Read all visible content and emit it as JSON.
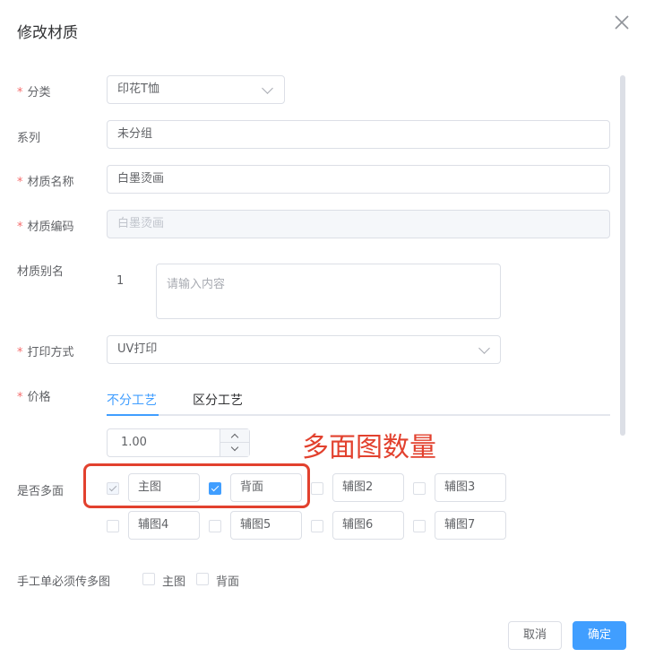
{
  "dialog": {
    "title": "修改材质",
    "cancel_label": "取消",
    "confirm_label": "确定"
  },
  "form": {
    "category": {
      "label": "分类",
      "required": true,
      "value": "印花T恤"
    },
    "series": {
      "label": "系列",
      "required": false,
      "value": "未分组"
    },
    "material_name": {
      "label": "材质名称",
      "required": true,
      "value": "白墨烫画"
    },
    "material_code": {
      "label": "材质编码",
      "required": true,
      "value": "白墨烫画"
    },
    "alias": {
      "label": "材质别名",
      "index": "1",
      "placeholder": "请输入内容"
    },
    "print_method": {
      "label": "打印方式",
      "required": true,
      "value": "UV打印"
    },
    "price": {
      "label": "价格",
      "required": true,
      "tabs": [
        "不分工艺",
        "区分工艺"
      ],
      "active_tab": 0,
      "value": "1.00"
    },
    "multi_face": {
      "label": "是否多面",
      "faces": [
        {
          "name": "主图",
          "checked": true,
          "disabled": true
        },
        {
          "name": "背面",
          "checked": true,
          "disabled": false
        },
        {
          "name": "辅图2",
          "checked": false,
          "disabled": false
        },
        {
          "name": "辅图3",
          "checked": false,
          "disabled": false
        },
        {
          "name": "辅图4",
          "checked": false,
          "disabled": false
        },
        {
          "name": "辅图5",
          "checked": false,
          "disabled": false
        },
        {
          "name": "辅图6",
          "checked": false,
          "disabled": false
        },
        {
          "name": "辅图7",
          "checked": false,
          "disabled": false
        }
      ]
    },
    "manual_required": {
      "label": "手工单必须传多图",
      "options": [
        "主图",
        "背面"
      ]
    }
  },
  "annotation": {
    "text": "多面图数量",
    "color": "#e2412e"
  },
  "colors": {
    "primary": "#409eff",
    "required_star": "#f56c6c",
    "border": "#dcdfe6"
  },
  "icons": {
    "close": "close-icon",
    "select_arrow": "chevron-down-icon"
  }
}
